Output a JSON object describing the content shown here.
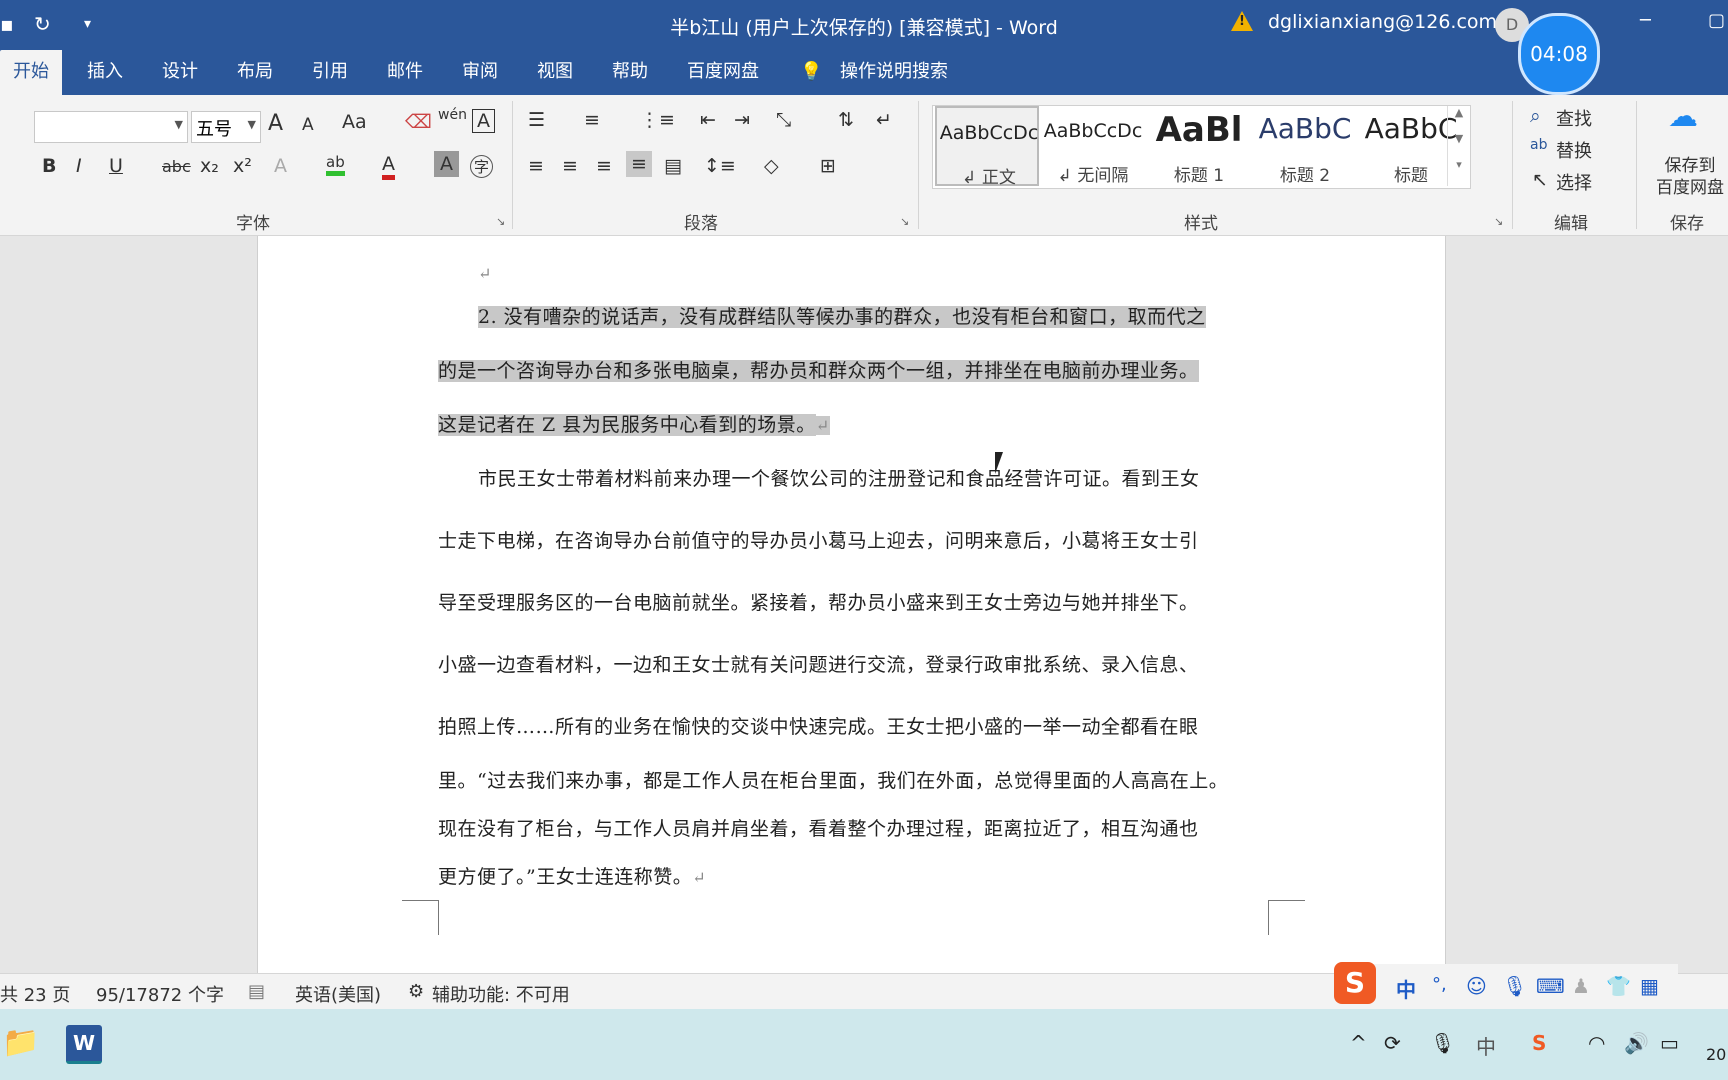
{
  "window": {
    "title": "半b江山 (用户上次保存的) [兼容模式]  -  Word",
    "account": "dglixianxiang@126.com",
    "avatar_letter": "D",
    "timer": "04:08"
  },
  "tabs": [
    "开始",
    "插入",
    "设计",
    "布局",
    "引用",
    "邮件",
    "审阅",
    "视图",
    "帮助",
    "百度网盘"
  ],
  "tell_me": "操作说明搜索",
  "ribbon": {
    "font_name": "",
    "font_size": "五号",
    "groups": {
      "font": "字体",
      "paragraph": "段落",
      "styles": "样式",
      "editing": "编辑",
      "save": "保存"
    },
    "styles": [
      {
        "preview": "AaBbCcDc",
        "name": "↲ 正文"
      },
      {
        "preview": "AaBbCcDc",
        "name": "↲ 无间隔"
      },
      {
        "preview": "AaBl",
        "name": "标题 1"
      },
      {
        "preview": "AaBbC",
        "name": "标题 2"
      },
      {
        "preview": "AaBbC",
        "name": "标题"
      }
    ],
    "editing": {
      "find": "查找",
      "replace": "替换",
      "select": "选择"
    },
    "save_to_baidu": [
      "保存到",
      "百度网盘"
    ],
    "font_buttons": {
      "bold": "B",
      "italic": "I",
      "underline": "U",
      "strike": "abc",
      "sub": "x₂",
      "sup": "x²",
      "grow": "A",
      "shrink": "A",
      "case": "Aa",
      "wen": "wén",
      "char_border": "A",
      "text_effect": "A",
      "highlight": "ab",
      "font_color": "A",
      "char_shade": "A",
      "enclose": "字"
    }
  },
  "document": {
    "lines": [
      {
        "text": "2. 没有嘈杂的说话声，没有成群结队等候办事的群众，也没有柜台和窗口，取而代之",
        "hl": true
      },
      {
        "text": "的是一个咨询导办台和多张电脑桌，帮办员和群众两个一组，并排坐在电脑前办理业务。",
        "hl": true
      },
      {
        "text": "这是记者在 Z 县为民服务中心看到的场景。",
        "hl": true
      },
      {
        "text": "市民王女士带着材料前来办理一个餐饮公司的注册登记和食品经营许可证。看到王女"
      },
      {
        "text": "士走下电梯，在咨询导办台前值守的导办员小葛马上迎去，问明来意后，小葛将王女士引"
      },
      {
        "text": "导至受理服务区的一台电脑前就坐。紧接着，帮办员小盛来到王女士旁边与她并排坐下。"
      },
      {
        "text": "小盛一边查看材料，一边和王女士就有关问题进行交流，登录行政审批系统、录入信息、"
      },
      {
        "text": "拍照上传……所有的业务在愉快的交谈中快速完成。王女士把小盛的一举一动全都看在眼"
      },
      {
        "text": "里。“过去我们来办事，都是工作人员在柜台里面，我们在外面，总觉得里面的人高高在上。"
      },
      {
        "text": "现在没有了柜台，与工作人员肩并肩坐着，看着整个办理过程，距离拉近了，相互沟通也"
      },
      {
        "text": "更方便了。”王女士连连称赞。"
      }
    ],
    "return_mark": "↵"
  },
  "statusbar": {
    "pages": "共 23 页",
    "words": "95/17872 个字",
    "language": "英语(美国)",
    "accessibility": "辅助功能: 不可用"
  },
  "ime": {
    "mode": "中",
    "punct": "°,"
  },
  "taskbar": {
    "ime_indicator": "中",
    "clock_partial": "20"
  }
}
